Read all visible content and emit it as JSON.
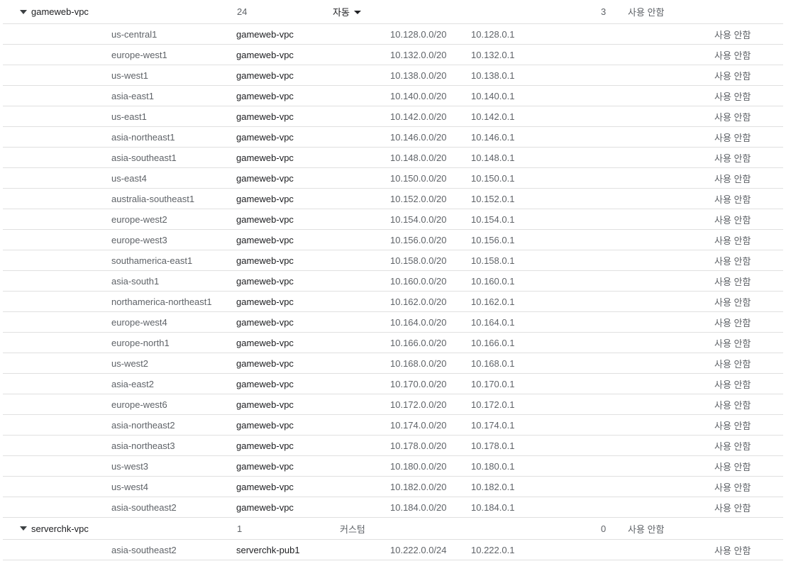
{
  "networks": [
    {
      "name": "gameweb-vpc",
      "subnet_count": "24",
      "mode": "자동",
      "firewall_rules": "3",
      "flow_logs": "사용 안함",
      "subnets": [
        {
          "region": "us-central1",
          "name": "gameweb-vpc",
          "range": "10.128.0.0/20",
          "gateway": "10.128.0.1",
          "private_access": "사용 안함"
        },
        {
          "region": "europe-west1",
          "name": "gameweb-vpc",
          "range": "10.132.0.0/20",
          "gateway": "10.132.0.1",
          "private_access": "사용 안함"
        },
        {
          "region": "us-west1",
          "name": "gameweb-vpc",
          "range": "10.138.0.0/20",
          "gateway": "10.138.0.1",
          "private_access": "사용 안함"
        },
        {
          "region": "asia-east1",
          "name": "gameweb-vpc",
          "range": "10.140.0.0/20",
          "gateway": "10.140.0.1",
          "private_access": "사용 안함"
        },
        {
          "region": "us-east1",
          "name": "gameweb-vpc",
          "range": "10.142.0.0/20",
          "gateway": "10.142.0.1",
          "private_access": "사용 안함"
        },
        {
          "region": "asia-northeast1",
          "name": "gameweb-vpc",
          "range": "10.146.0.0/20",
          "gateway": "10.146.0.1",
          "private_access": "사용 안함"
        },
        {
          "region": "asia-southeast1",
          "name": "gameweb-vpc",
          "range": "10.148.0.0/20",
          "gateway": "10.148.0.1",
          "private_access": "사용 안함"
        },
        {
          "region": "us-east4",
          "name": "gameweb-vpc",
          "range": "10.150.0.0/20",
          "gateway": "10.150.0.1",
          "private_access": "사용 안함"
        },
        {
          "region": "australia-southeast1",
          "name": "gameweb-vpc",
          "range": "10.152.0.0/20",
          "gateway": "10.152.0.1",
          "private_access": "사용 안함"
        },
        {
          "region": "europe-west2",
          "name": "gameweb-vpc",
          "range": "10.154.0.0/20",
          "gateway": "10.154.0.1",
          "private_access": "사용 안함"
        },
        {
          "region": "europe-west3",
          "name": "gameweb-vpc",
          "range": "10.156.0.0/20",
          "gateway": "10.156.0.1",
          "private_access": "사용 안함"
        },
        {
          "region": "southamerica-east1",
          "name": "gameweb-vpc",
          "range": "10.158.0.0/20",
          "gateway": "10.158.0.1",
          "private_access": "사용 안함"
        },
        {
          "region": "asia-south1",
          "name": "gameweb-vpc",
          "range": "10.160.0.0/20",
          "gateway": "10.160.0.1",
          "private_access": "사용 안함"
        },
        {
          "region": "northamerica-northeast1",
          "name": "gameweb-vpc",
          "range": "10.162.0.0/20",
          "gateway": "10.162.0.1",
          "private_access": "사용 안함"
        },
        {
          "region": "europe-west4",
          "name": "gameweb-vpc",
          "range": "10.164.0.0/20",
          "gateway": "10.164.0.1",
          "private_access": "사용 안함"
        },
        {
          "region": "europe-north1",
          "name": "gameweb-vpc",
          "range": "10.166.0.0/20",
          "gateway": "10.166.0.1",
          "private_access": "사용 안함"
        },
        {
          "region": "us-west2",
          "name": "gameweb-vpc",
          "range": "10.168.0.0/20",
          "gateway": "10.168.0.1",
          "private_access": "사용 안함"
        },
        {
          "region": "asia-east2",
          "name": "gameweb-vpc",
          "range": "10.170.0.0/20",
          "gateway": "10.170.0.1",
          "private_access": "사용 안함"
        },
        {
          "region": "europe-west6",
          "name": "gameweb-vpc",
          "range": "10.172.0.0/20",
          "gateway": "10.172.0.1",
          "private_access": "사용 안함"
        },
        {
          "region": "asia-northeast2",
          "name": "gameweb-vpc",
          "range": "10.174.0.0/20",
          "gateway": "10.174.0.1",
          "private_access": "사용 안함"
        },
        {
          "region": "asia-northeast3",
          "name": "gameweb-vpc",
          "range": "10.178.0.0/20",
          "gateway": "10.178.0.1",
          "private_access": "사용 안함"
        },
        {
          "region": "us-west3",
          "name": "gameweb-vpc",
          "range": "10.180.0.0/20",
          "gateway": "10.180.0.1",
          "private_access": "사용 안함"
        },
        {
          "region": "us-west4",
          "name": "gameweb-vpc",
          "range": "10.182.0.0/20",
          "gateway": "10.182.0.1",
          "private_access": "사용 안함"
        },
        {
          "region": "asia-southeast2",
          "name": "gameweb-vpc",
          "range": "10.184.0.0/20",
          "gateway": "10.184.0.1",
          "private_access": "사용 안함"
        }
      ]
    },
    {
      "name": "serverchk-vpc",
      "subnet_count": "1",
      "mode": "커스텀",
      "firewall_rules": "0",
      "flow_logs": "사용 안함",
      "subnets": [
        {
          "region": "asia-southeast2",
          "name": "serverchk-pub1",
          "range": "10.222.0.0/24",
          "gateway": "10.222.0.1",
          "private_access": "사용 안함"
        }
      ]
    }
  ],
  "icons": {
    "expand": "caret-down-icon",
    "mode_dropdown": "caret-down-icon"
  },
  "colors": {
    "text": "#202124",
    "muted": "#5f6368",
    "divider": "#e0e0e0"
  }
}
